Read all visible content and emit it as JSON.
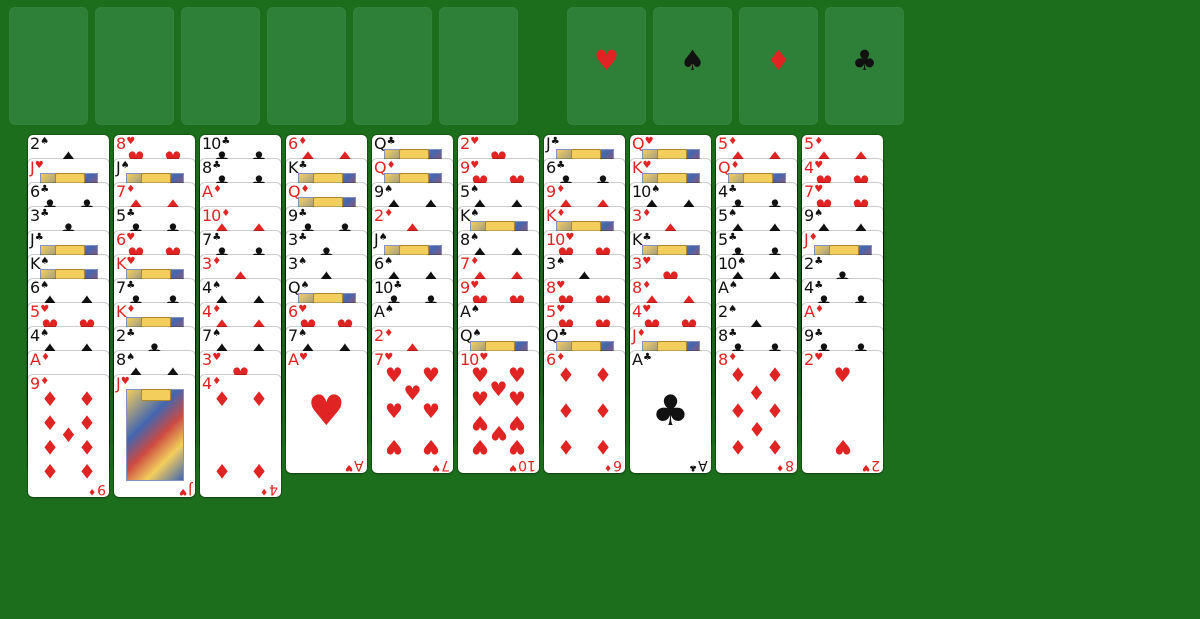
{
  "free_cells": [
    {
      "label": ""
    },
    {
      "label": ""
    },
    {
      "label": ""
    },
    {
      "label": ""
    },
    {
      "label": ""
    },
    {
      "label": ""
    }
  ],
  "foundations": [
    {
      "suit": "♥",
      "color": "red",
      "icon": "heart-icon"
    },
    {
      "suit": "♠",
      "color": "black",
      "icon": "spade-icon"
    },
    {
      "suit": "♦",
      "color": "red",
      "icon": "diamond-icon"
    },
    {
      "suit": "♣",
      "color": "black",
      "icon": "club-icon"
    }
  ],
  "columns": [
    [
      [
        "2",
        "♠"
      ],
      [
        "J",
        "♥"
      ],
      [
        "6",
        "♣"
      ],
      [
        "3",
        "♣"
      ],
      [
        "J",
        "♣"
      ],
      [
        "K",
        "♠"
      ],
      [
        "6",
        "♠"
      ],
      [
        "5",
        "♥"
      ],
      [
        "4",
        "♠"
      ],
      [
        "A",
        "♦"
      ],
      [
        "9",
        "♦"
      ]
    ],
    [
      [
        "8",
        "♥"
      ],
      [
        "J",
        "♠"
      ],
      [
        "7",
        "♦"
      ],
      [
        "5",
        "♣"
      ],
      [
        "6",
        "♥"
      ],
      [
        "K",
        "♥"
      ],
      [
        "7",
        "♣"
      ],
      [
        "K",
        "♦"
      ],
      [
        "2",
        "♣"
      ],
      [
        "8",
        "♠"
      ],
      [
        "J",
        "♥"
      ]
    ],
    [
      [
        "10",
        "♣"
      ],
      [
        "8",
        "♣"
      ],
      [
        "A",
        "♦"
      ],
      [
        "10",
        "♦"
      ],
      [
        "7",
        "♣"
      ],
      [
        "3",
        "♦"
      ],
      [
        "4",
        "♠"
      ],
      [
        "4",
        "♦"
      ],
      [
        "7",
        "♠"
      ],
      [
        "3",
        "♥"
      ],
      [
        "4",
        "♦"
      ]
    ],
    [
      [
        "6",
        "♦"
      ],
      [
        "K",
        "♣"
      ],
      [
        "Q",
        "♦"
      ],
      [
        "9",
        "♣"
      ],
      [
        "3",
        "♣"
      ],
      [
        "3",
        "♠"
      ],
      [
        "Q",
        "♠"
      ],
      [
        "6",
        "♥"
      ],
      [
        "7",
        "♠"
      ],
      [
        "A",
        "♥"
      ]
    ],
    [
      [
        "Q",
        "♣"
      ],
      [
        "Q",
        "♦"
      ],
      [
        "9",
        "♠"
      ],
      [
        "2",
        "♦"
      ],
      [
        "J",
        "♠"
      ],
      [
        "6",
        "♠"
      ],
      [
        "10",
        "♣"
      ],
      [
        "A",
        "♠"
      ],
      [
        "2",
        "♦"
      ],
      [
        "7",
        "♥"
      ]
    ],
    [
      [
        "2",
        "♥"
      ],
      [
        "9",
        "♥"
      ],
      [
        "5",
        "♠"
      ],
      [
        "K",
        "♠"
      ],
      [
        "8",
        "♠"
      ],
      [
        "7",
        "♦"
      ],
      [
        "9",
        "♥"
      ],
      [
        "A",
        "♠"
      ],
      [
        "Q",
        "♠"
      ],
      [
        "10",
        "♥"
      ]
    ],
    [
      [
        "J",
        "♣"
      ],
      [
        "6",
        "♣"
      ],
      [
        "9",
        "♦"
      ],
      [
        "K",
        "♦"
      ],
      [
        "10",
        "♥"
      ],
      [
        "3",
        "♠"
      ],
      [
        "8",
        "♥"
      ],
      [
        "5",
        "♥"
      ],
      [
        "Q",
        "♣"
      ],
      [
        "6",
        "♦"
      ]
    ],
    [
      [
        "Q",
        "♥"
      ],
      [
        "K",
        "♥"
      ],
      [
        "10",
        "♠"
      ],
      [
        "3",
        "♦"
      ],
      [
        "K",
        "♣"
      ],
      [
        "3",
        "♥"
      ],
      [
        "8",
        "♦"
      ],
      [
        "4",
        "♥"
      ],
      [
        "J",
        "♦"
      ],
      [
        "A",
        "♣"
      ]
    ],
    [
      [
        "5",
        "♦"
      ],
      [
        "Q",
        "♦"
      ],
      [
        "4",
        "♣"
      ],
      [
        "5",
        "♠"
      ],
      [
        "5",
        "♣"
      ],
      [
        "10",
        "♠"
      ],
      [
        "A",
        "♠"
      ],
      [
        "2",
        "♠"
      ],
      [
        "8",
        "♣"
      ],
      [
        "8",
        "♦"
      ]
    ],
    [
      [
        "5",
        "♦"
      ],
      [
        "4",
        "♥"
      ],
      [
        "7",
        "♥"
      ],
      [
        "9",
        "♠"
      ],
      [
        "J",
        "♦"
      ],
      [
        "2",
        "♣"
      ],
      [
        "4",
        "♣"
      ],
      [
        "A",
        "♦"
      ],
      [
        "9",
        "♣"
      ],
      [
        "2",
        "♥"
      ]
    ]
  ]
}
